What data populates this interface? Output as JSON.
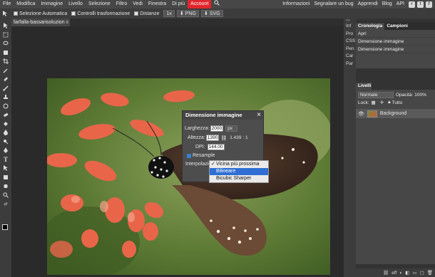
{
  "menubar": {
    "items": [
      "File",
      "Modifica",
      "Immagine",
      "Livello",
      "Selezione",
      "Filtro",
      "Vedi",
      "Finestra",
      "Di più",
      "Account"
    ],
    "right_links": [
      "Informazioni",
      "Segnalare un bug",
      "Apprendi",
      "Blog",
      "API"
    ],
    "account_color": "#e0262c"
  },
  "options": {
    "auto_select": "Selezione Automatica",
    "transform_controls": "Controlli trasformazione",
    "distances": "Distanze",
    "zoom": "1x",
    "png": "PNG",
    "svg": "SVG"
  },
  "doc": {
    "tab_name": "farfalla-bassarisoluzion",
    "tab_close": "x"
  },
  "dialog": {
    "title": "Dimensione immagine",
    "close": "×",
    "width_label": "Larghezza:",
    "width_value": "2000",
    "unit": "px",
    "height_label": "Altezza:",
    "height_value": "1390",
    "ratio": "1.439 : 1",
    "dpi_label": "DPI:",
    "dpi_value": "144.00",
    "resample_label": "Resample",
    "interp_label": "Interpolazio"
  },
  "dropdown": {
    "options": [
      "Vicina più prossima",
      "Bilineare",
      "Bicubic Sharper"
    ],
    "checked_index": 0,
    "highlighted_index": 1,
    "highlight_color": "#2f6fd3"
  },
  "mini_panel": {
    "items": [
      "Inf",
      "Pro",
      "CSS",
      "Pen",
      "Car",
      "Par"
    ]
  },
  "history": {
    "tabs": [
      "Cronologia",
      "Campioni"
    ],
    "entries": [
      "Apri",
      "Dimensione immagine",
      "Dimensione immagine"
    ]
  },
  "layers": {
    "tab": "Livelli",
    "blend_mode": "Normale",
    "opacity_label": "Opacità:",
    "opacity_value": "100%",
    "lock_label": "Lock:",
    "all_label": "Tutto",
    "layer_name": "Background"
  },
  "footer": {
    "fx_label": "eff"
  }
}
